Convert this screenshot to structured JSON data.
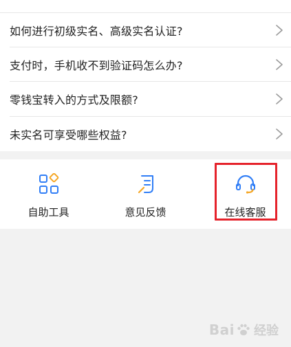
{
  "faq": {
    "items": [
      {
        "label": "如何进行初级实名、高级实名认证?"
      },
      {
        "label": "支付时，手机收不到验证码怎么办?"
      },
      {
        "label": "零钱宝转入的方式及限额?"
      },
      {
        "label": "未实名可享受哪些权益?"
      }
    ]
  },
  "tools": {
    "self_help": "自助工具",
    "feedback": "意见反馈",
    "online_service": "在线客服"
  },
  "colors": {
    "accent_blue": "#2f7df6",
    "accent_orange": "#f5a623",
    "highlight_red": "#e5222b"
  },
  "watermark": {
    "brand": "Bai",
    "suffix": "经验"
  }
}
